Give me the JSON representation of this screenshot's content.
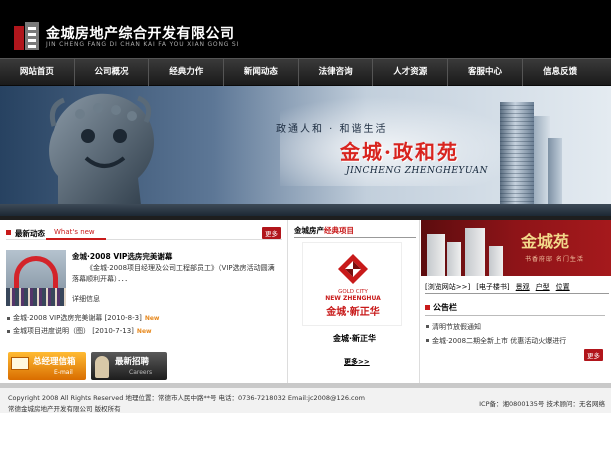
{
  "header": {
    "company_name": "金城房地产综合开发有限公司",
    "company_pinyin": "JIN CHENG FANG DI CHAN KAI FA YOU XIAN GONG SI"
  },
  "nav": {
    "items": [
      {
        "label": "网站首页"
      },
      {
        "label": "公司概况"
      },
      {
        "label": "经典力作"
      },
      {
        "label": "新闻动态"
      },
      {
        "label": "法律咨询"
      },
      {
        "label": "人才资源"
      },
      {
        "label": "客服中心"
      },
      {
        "label": "信息反馈"
      }
    ]
  },
  "banner": {
    "slogan": "政通人和  ·  和谐生活",
    "title": "金城·政和苑",
    "pinyin": "JINCHENG ZHENGHEYUAN"
  },
  "news": {
    "heading": "最新动态",
    "heading_en": "What's new",
    "more": "更多",
    "featured_title": "金城·2008 VIP选房完美谢幕",
    "featured_desc": "《金城·2008项目经理及公司工程部员工》（VIP选房活动圆满落幕顺利开幕）．．．",
    "detail_label": "详细信息",
    "items": [
      {
        "text": "金城·2008 VIP选房完美谢幕 [2010-8-3]",
        "badge": "New"
      },
      {
        "text": "金城项目进度说明（图） [2010-7-13]",
        "badge": "New"
      }
    ]
  },
  "buttons": {
    "mail_title": "总经理信箱",
    "mail_sub": "E-mail",
    "job_title": "最新招聘",
    "job_sub": "Careers"
  },
  "projects": {
    "heading_prefix": "金城房产",
    "heading_accent": "经典项目",
    "logo_en1": "GOLD CITY",
    "logo_en2": "NEW ZHENGHUA",
    "logo_cn": "金城·新正华",
    "name": "金城·新正华",
    "more": "更多>>"
  },
  "right": {
    "banner_title": "金城苑",
    "banner_slogan": "书香府邸 名门生活",
    "tabs": [
      {
        "label": "[浏览网站>>]"
      },
      {
        "label": "[电子楼书]"
      },
      {
        "label": "景观"
      },
      {
        "label": "户型"
      },
      {
        "label": "位置"
      }
    ],
    "notice_heading": "公告栏",
    "notices": [
      {
        "text": "清明节放假通知"
      },
      {
        "text": "金城·2008二期全新上市 优惠活动火爆进行"
      }
    ],
    "more": "更多"
  },
  "footer": {
    "line1": "Copyright 2008 All Rights Reserved 地理位置：常德市人民中路**号 电话：0736-7218032 Email:jc2008@126.com",
    "line2": "常德金城房地产开发有限公司 版权所有",
    "icp": "ICP备：湘0800135号 技术顾问：无名网络"
  },
  "colors": {
    "brand_red": "#c81a1a",
    "header_black": "#000000",
    "mail_orange": "#ff9900"
  }
}
